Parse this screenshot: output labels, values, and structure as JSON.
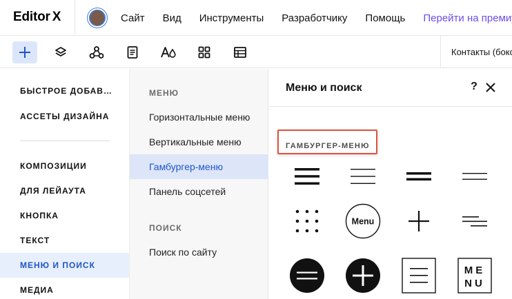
{
  "app": {
    "logo": "Editor",
    "logo_mark": "X"
  },
  "topmenu": {
    "items": [
      "Сайт",
      "Вид",
      "Инструменты",
      "Разработчику",
      "Помощь"
    ],
    "premium": "Перейти на премиум"
  },
  "toolbar": {
    "tools": [
      "plus-icon",
      "layers-icon",
      "connections-icon",
      "page-icon",
      "theme-icon",
      "apps-icon",
      "table-icon"
    ],
    "active_tool": "plus-icon",
    "page_name": "Контакты (боко"
  },
  "left_categories": {
    "items": [
      "БЫСТРОЕ ДОБАВ…",
      "АССЕТЫ ДИЗАЙНА",
      "КОМПОЗИЦИИ",
      "ДЛЯ ЛЕЙАУТА",
      "КНОПКА",
      "ТЕКСТ",
      "МЕНЮ И ПОИСК",
      "МЕДИА"
    ],
    "active": "МЕНЮ И ПОИСК"
  },
  "middle": {
    "menu_heading": "МЕНЮ",
    "menu_items": [
      "Горизонтальные меню",
      "Вертикальные меню",
      "Гамбургер-меню",
      "Панель соцсетей"
    ],
    "active": "Гамбургер-меню",
    "search_heading": "ПОИСК",
    "search_items": [
      "Поиск по сайту"
    ]
  },
  "panel": {
    "title": "Меню и поиск",
    "help": "?",
    "group_label": "ГАМБУРГЕР-МЕНЮ",
    "icons": [
      "hamburger-thick-icon",
      "hamburger-thin-icon",
      "hamburger-two-thick-icon",
      "hamburger-two-thin-icon",
      "dots-grid-icon",
      "menu-circle-icon",
      "plus-thin-icon",
      "hamburger-offset-icon",
      "black-circle-equals-icon",
      "black-circle-plus-icon",
      "boxed-lines-icon",
      "boxed-menu-icon"
    ],
    "menu_circle_text": "Menu",
    "boxed_menu_line1": "ME",
    "boxed_menu_line2": "NU"
  },
  "colors": {
    "accent": "#1e55c9",
    "active_bg": "#e7effc",
    "premium": "#6a4de8",
    "highlight_box": "#e1523f"
  }
}
